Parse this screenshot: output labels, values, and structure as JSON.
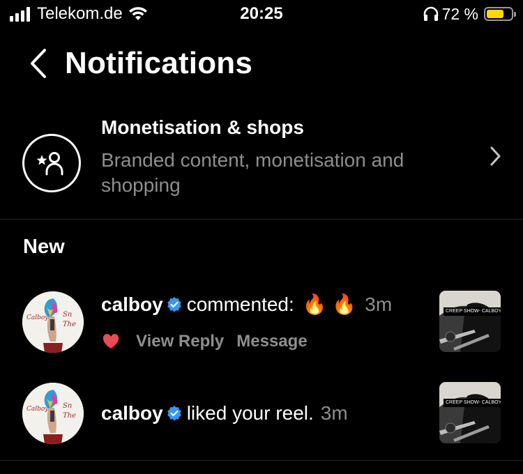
{
  "status_bar": {
    "carrier": "Telekom.de",
    "time": "20:25",
    "battery_percent": "72 %",
    "battery_level": 0.72
  },
  "header": {
    "title": "Notifications"
  },
  "monetisation": {
    "title": "Monetisation & shops",
    "subtitle": "Branded content, monetisation and shopping"
  },
  "section": {
    "title": "New"
  },
  "notifications": [
    {
      "username": "calboy",
      "text": "commented:",
      "emoji": "🔥 🔥",
      "time": "3m",
      "actions": [
        "View Reply",
        "Message"
      ],
      "thumb_text": "CREEP SHOW- CALBOY"
    },
    {
      "username": "calboy",
      "text": "liked your reel.",
      "time": "3m",
      "thumb_text": "CREEP SHOW- CALBOY"
    }
  ],
  "colors": {
    "background": "#000000",
    "muted": "#8e8e8e",
    "verified": "#3897f0",
    "heart": "#ed4956",
    "battery": "#ffd60a"
  }
}
